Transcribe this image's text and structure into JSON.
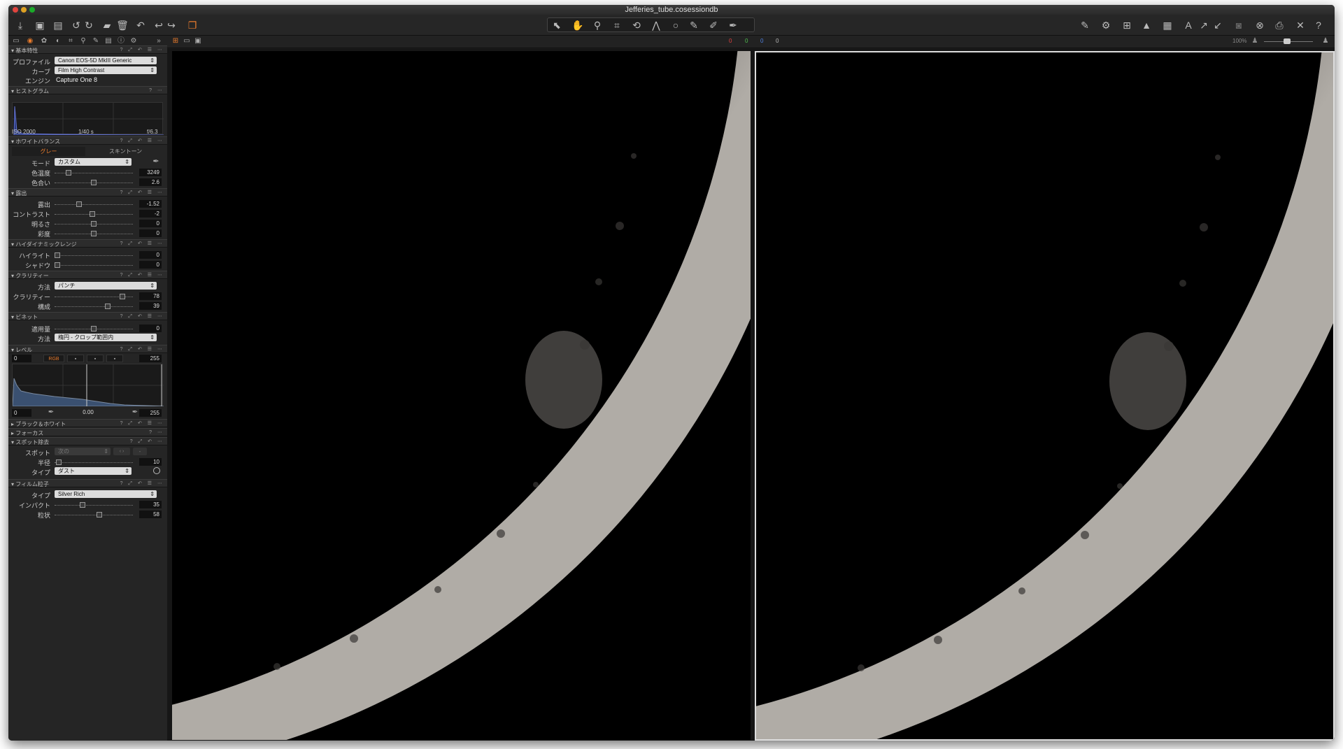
{
  "window": {
    "title": "Jefferies_tube.cosessiondb"
  },
  "toolbar": {
    "left_icons": [
      "import-icon",
      "capture-icon",
      "browser-icon",
      "rotate-left-icon",
      "rotate-right-icon",
      "album-icon",
      "trash-icon",
      "undo-icon",
      "redo-icon",
      "history-icon",
      "variant-icon"
    ],
    "right_icons": [
      "pen-icon",
      "gear-icon",
      "grid-icon",
      "warning-icon",
      "grid2-icon",
      "text-icon",
      "arrows-in-icon",
      "arrows-out-icon",
      "camera-icon",
      "close-circle-icon",
      "printer-icon",
      "tools-icon",
      "help-icon"
    ]
  },
  "viewer_counts": [
    "0",
    "0",
    "0",
    "0"
  ],
  "zoom": "100%",
  "panel": {
    "basic": {
      "title": "基本特性",
      "profile_label": "プロファイル",
      "profile_value": "Canon EOS-5D MkIII Generic",
      "curve_label": "カーブ",
      "curve_value": "Film High Contrast",
      "engine_label": "エンジン",
      "engine_value": "Capture One 8"
    },
    "histogram": {
      "title": "ヒストグラム",
      "iso": "ISO 2000",
      "shutter": "1/40 s",
      "aperture": "f/6.3"
    },
    "white_balance": {
      "title": "ホワイトバランス",
      "tab_gray": "グレー",
      "tab_skin": "スキントーン",
      "mode_label": "モード",
      "mode_value": "カスタム",
      "kelvin_label": "色温度",
      "kelvin_value": "3249",
      "kelvin_frac": 0.15,
      "tint_label": "色合い",
      "tint_value": "2.6",
      "tint_frac": 0.5
    },
    "exposure": {
      "title": "露出",
      "exposure_label": "露出",
      "exposure_value": "-1.52",
      "exposure_frac": 0.3,
      "contrast_label": "コントラスト",
      "contrast_value": "-2",
      "contrast_frac": 0.48,
      "brightness_label": "明るさ",
      "brightness_value": "0",
      "brightness_frac": 0.5,
      "saturation_label": "彩度",
      "saturation_value": "0",
      "saturation_frac": 0.5
    },
    "hdr": {
      "title": "ハイダイナミックレンジ",
      "highlight_label": "ハイライト",
      "highlight_value": "0",
      "highlight_frac": 0.0,
      "shadow_label": "シャドウ",
      "shadow_value": "0",
      "shadow_frac": 0.0
    },
    "clarity": {
      "title": "クラリティー",
      "method_label": "方法",
      "method_value": "パンチ",
      "clarity_label": "クラリティー",
      "clarity_value": "78",
      "clarity_frac": 0.89,
      "structure_label": "構成",
      "structure_value": "39",
      "structure_frac": 0.69
    },
    "vignette": {
      "title": "ビネット",
      "amount_label": "適用量",
      "amount_value": "0",
      "amount_frac": 0.5,
      "method_label": "方法",
      "method_value": "楕円 - クロップ範囲内"
    },
    "levels": {
      "title": "レベル",
      "in_low": "0",
      "in_high": "255",
      "mode": "RGB",
      "out_low": "0",
      "mid": "0.00",
      "out_high": "255"
    },
    "bw": {
      "title": "ブラック＆ホワイト"
    },
    "focus": {
      "title": "フォーカス"
    },
    "spot": {
      "title": "スポット除去",
      "spot_label": "スポット",
      "spot_value": "次の",
      "radius_label": "半径",
      "radius_value": "10",
      "radius_frac": 0.02,
      "type_label": "タイプ",
      "type_value": "ダスト"
    },
    "grain": {
      "title": "フィルム粒子",
      "type_label": "タイプ",
      "type_value": "Silver Rich",
      "impact_label": "インパクト",
      "impact_value": "35",
      "impact_frac": 0.35,
      "granularity_label": "粒状",
      "granularity_value": "58",
      "granularity_frac": 0.58
    }
  }
}
